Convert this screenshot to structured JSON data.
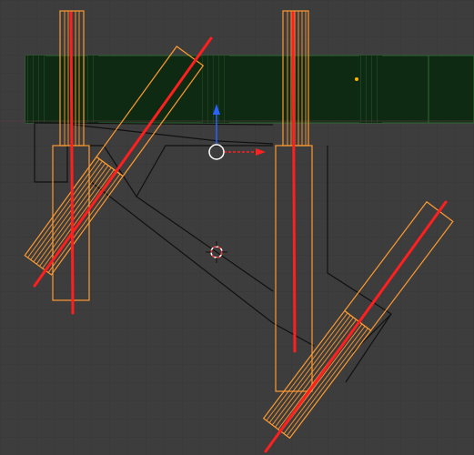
{
  "viewport": {
    "background": "#3d3d3d",
    "grid_color": "#363636",
    "icons": [
      "transform-gizmo-icon",
      "3d-cursor-icon",
      "pivot-origin-icon"
    ]
  },
  "colors": {
    "green_object": "#0f2a12",
    "green_edge": "#2f6a34",
    "selected_orange": "#ff9a30",
    "red_line": "#ff1f1f",
    "wire": "#101010",
    "gizmo_blue": "#2a62ff",
    "gizmo_red": "#ff2020",
    "origin_orange": "#ffb400"
  },
  "scene_objects": [
    "green-track-strip",
    "left-vertical-bar",
    "left-tilted-bar",
    "right-vertical-bar",
    "right-tilted-bar",
    "black-wire-frame"
  ]
}
